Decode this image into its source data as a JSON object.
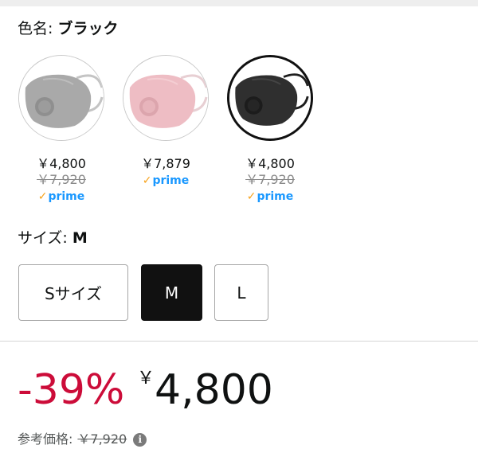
{
  "color": {
    "label": "色名: ",
    "value": "ブラック",
    "options": [
      {
        "name": "gray",
        "price": "￥4,800",
        "was": "￥7,920",
        "prime": "prime",
        "fill": "#a9a9a9",
        "strap": "#c4c4c4"
      },
      {
        "name": "pink",
        "price": "￥7,879",
        "was": "",
        "prime": "prime",
        "fill": "#eebdc4",
        "strap": "#e7cfd3"
      },
      {
        "name": "black",
        "price": "￥4,800",
        "was": "￥7,920",
        "prime": "prime",
        "fill": "#2f2f2f",
        "strap": "#1e1e1e"
      }
    ]
  },
  "size": {
    "label": "サイズ: ",
    "value": "M",
    "options": [
      "Sサイズ",
      "M",
      "L"
    ]
  },
  "price": {
    "discount": "-39%",
    "currency": "￥",
    "amount": "4,800"
  },
  "reference": {
    "label": "参考価格:",
    "was": "￥7,920",
    "info": "i"
  },
  "colors": {
    "accent_red": "#cc0c39",
    "prime_blue": "#1a98ff",
    "prime_check": "#f7a21b"
  }
}
